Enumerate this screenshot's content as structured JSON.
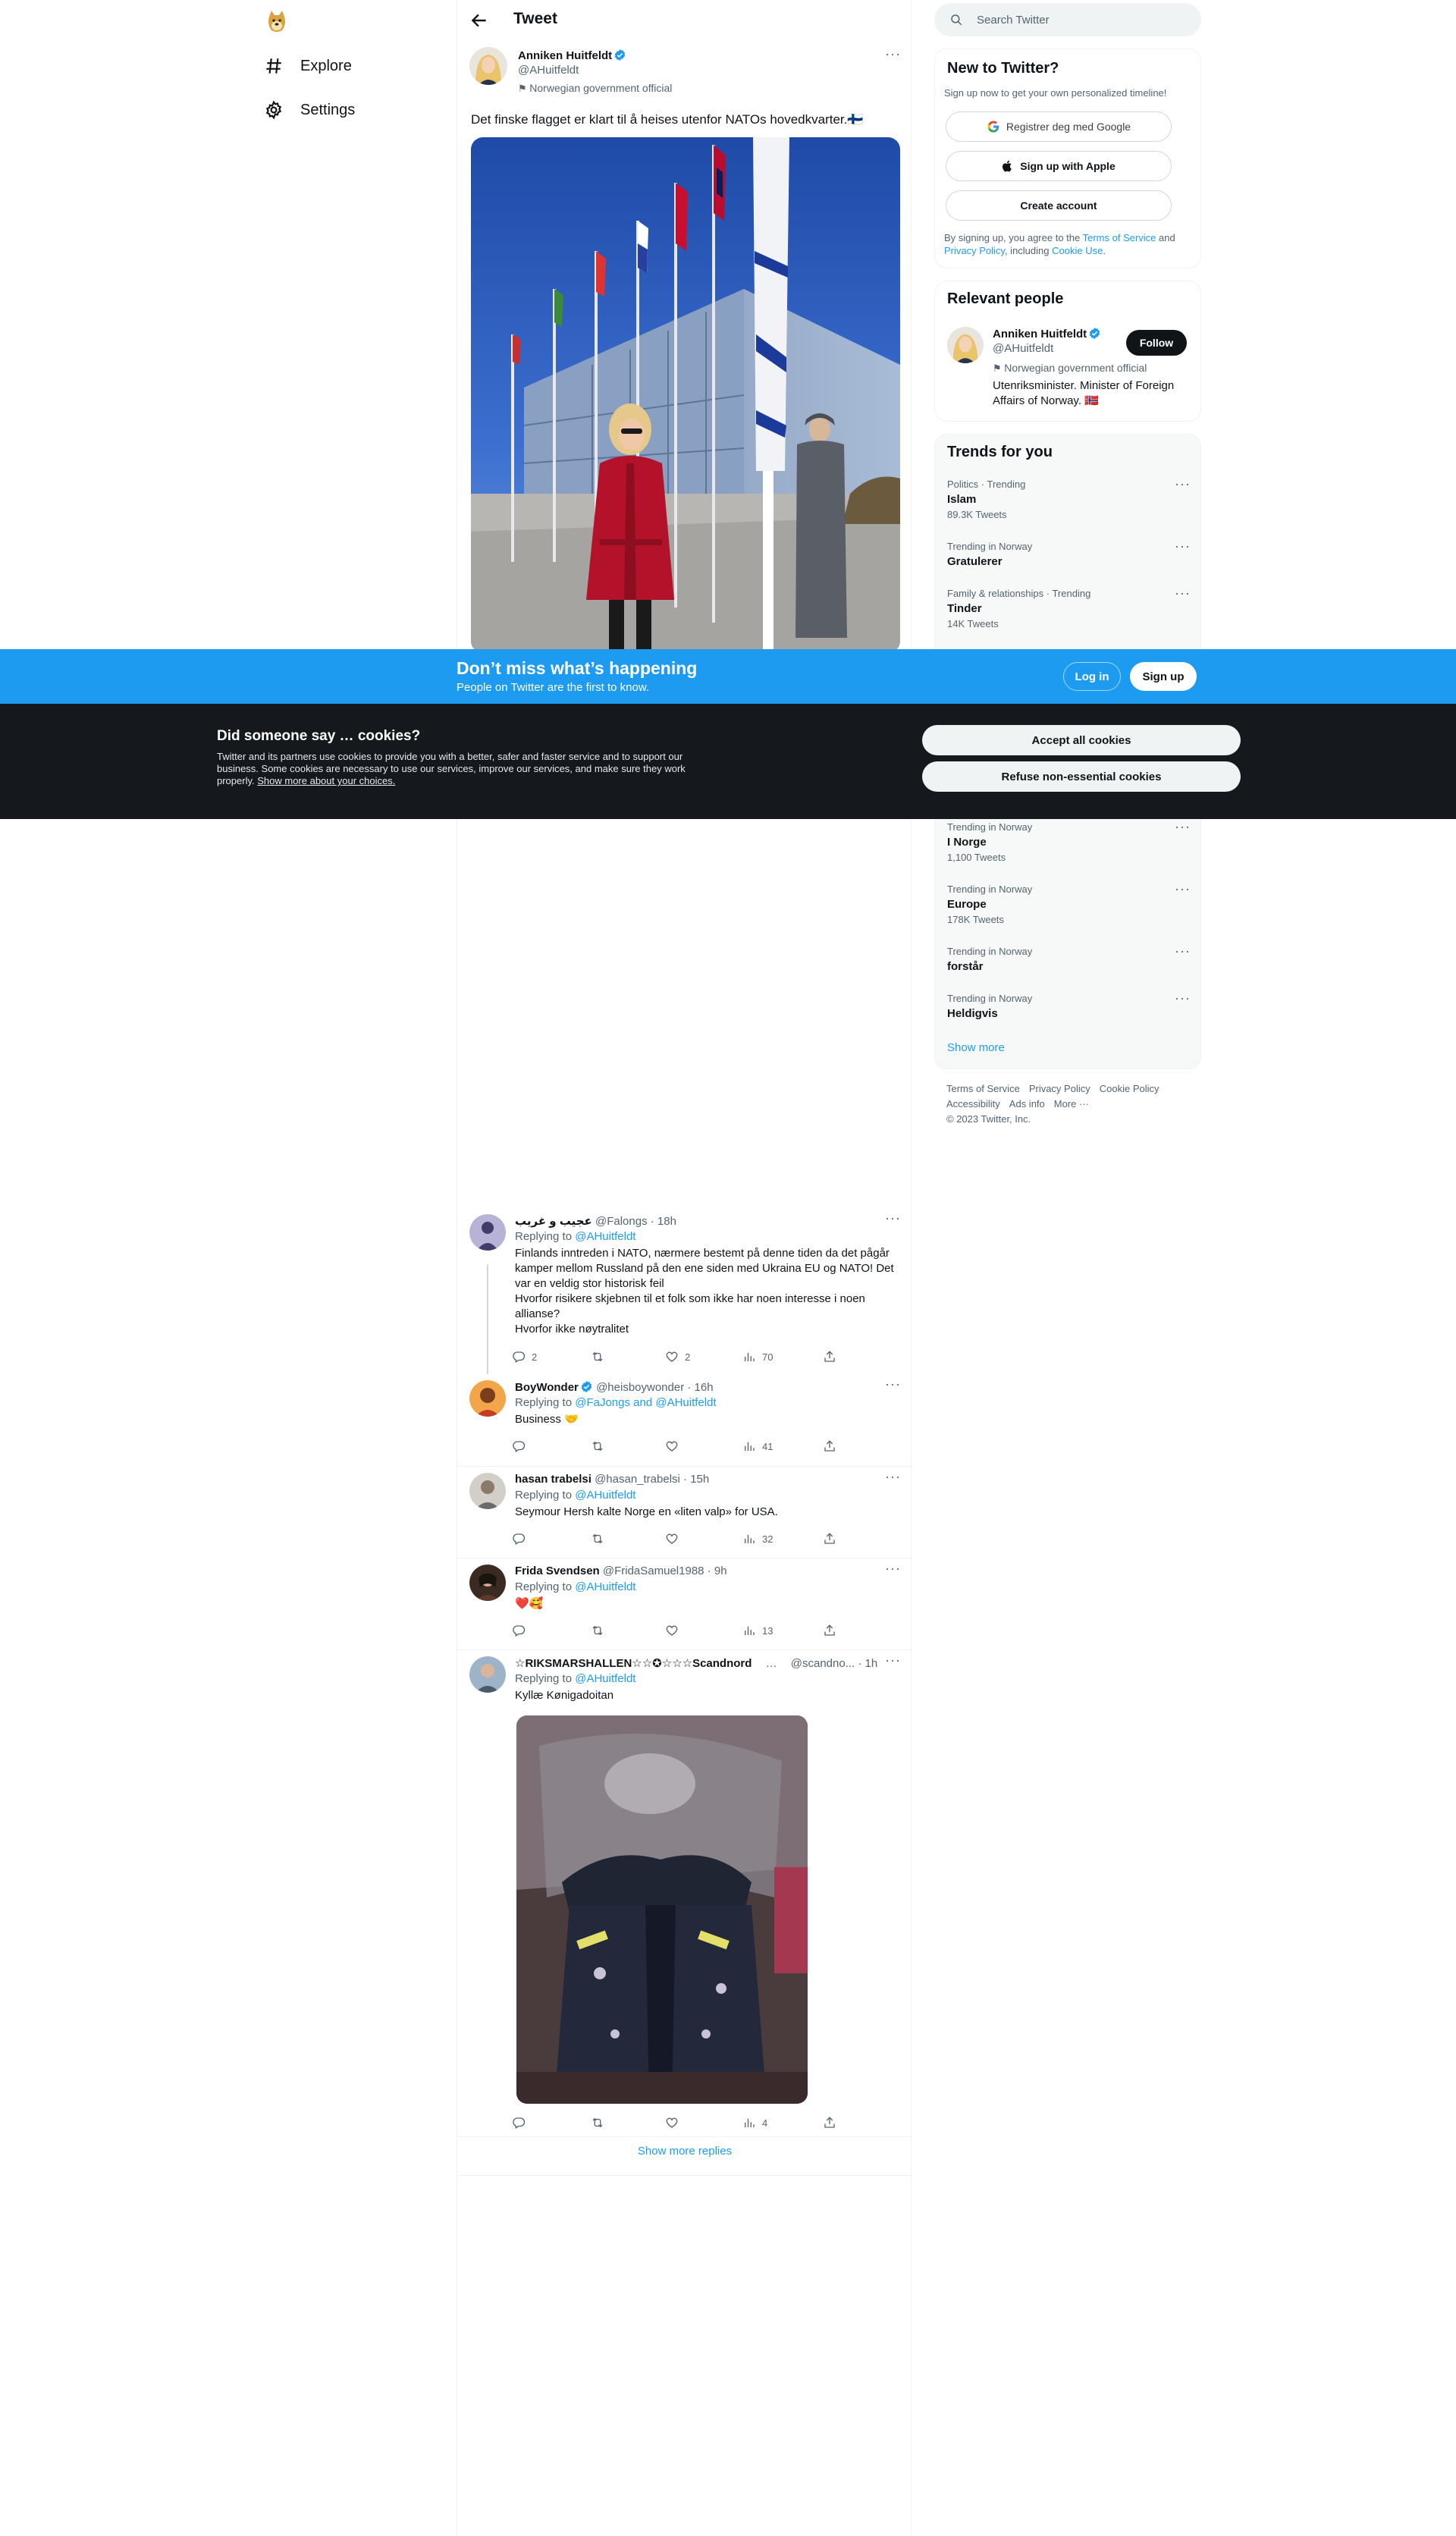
{
  "nav": {
    "explore_label": "Explore",
    "settings_label": "Settings"
  },
  "topbar": {
    "title": "Tweet"
  },
  "tweet": {
    "author_name": "Anniken Huitfeldt",
    "author_handle": "@AHuitfeldt",
    "affiliation": "Norwegian government official",
    "text": "Det finske flagget er klart til å heises utenfor NATOs hovedkvarter.🇫🇮"
  },
  "replies": [
    {
      "name": "عجيب و غريب",
      "handle": "@Falongs",
      "time": "· 18h",
      "replying_prefix": "Replying to ",
      "replying_to": "@AHuitfeldt",
      "text": "Finlands inntreden i NATO, nærmere bestemt på denne tiden da det pågår kamper mellom Russland på den ene siden med Ukraina EU og NATO! Det var en veldig stor historisk feil\nHvorfor risikere skjebnen til et folk som ikke har noen interesse i noen allianse?\nHvorfor ikke nøytralitet",
      "stats": {
        "replies": "2",
        "retweets": "",
        "likes": "2",
        "views": "70"
      }
    },
    {
      "name": "BoyWonder",
      "handle": "@heisboywonder",
      "time": "· 16h",
      "replying_prefix": "Replying to ",
      "replying_to": "@FaJongs and @AHuitfeldt",
      "text": "Business 🤝",
      "stats": {
        "replies": "",
        "retweets": "",
        "likes": "",
        "views": "41"
      }
    },
    {
      "name": "hasan trabelsi",
      "handle": "@hasan_trabelsi",
      "time": "· 15h",
      "replying_prefix": "Replying to ",
      "replying_to": "@AHuitfeldt",
      "text": "Seymour Hersh kalte Norge en «liten valp» for USA.",
      "stats": {
        "replies": "",
        "retweets": "",
        "likes": "",
        "views": "32"
      }
    },
    {
      "name": "Frida Svendsen",
      "handle": "@FridaSamuel1988",
      "time": "· 9h",
      "replying_prefix": "Replying to ",
      "replying_to": "@AHuitfeldt",
      "text": "❤️🥰",
      "stats": {
        "replies": "",
        "retweets": "",
        "likes": "",
        "views": "13"
      }
    },
    {
      "name": "☆RIKSMARSHALLEN☆☆✪☆☆☆Scandnord",
      "handle": "@scandno...",
      "time": "· 1h",
      "replying_prefix": "Replying to ",
      "replying_to": "@AHuitfeldt",
      "text": "Kyllæ Kønigadoitan",
      "stats": {
        "replies": "",
        "retweets": "",
        "likes": "",
        "views": "4"
      }
    }
  ],
  "show_more_replies": "Show more replies",
  "search": {
    "placeholder": "Search Twitter"
  },
  "signup_panel": {
    "title": "New to Twitter?",
    "subtitle": "Sign up now to get your own personalized timeline!",
    "google_label": "Registrer deg med Google",
    "apple_label": "Sign up with Apple",
    "create_label": "Create account",
    "terms_prefix": "By signing up, you agree to the ",
    "terms_link": "Terms of Service",
    "terms_and": " and ",
    "privacy_link": "Privacy Policy",
    "terms_including": ", including ",
    "cookie_link": "Cookie Use",
    "terms_end": "."
  },
  "relevant": {
    "title": "Relevant people",
    "name": "Anniken Huitfeldt",
    "handle": "@AHuitfeldt",
    "follow_label": "Follow",
    "affiliation": "Norwegian government official",
    "bio": "Utenriksminister. Minister of Foreign Affairs of Norway. 🇳🇴"
  },
  "trends": {
    "title": "Trends for you",
    "items_top": [
      {
        "context": "Politics · Trending",
        "name": "Islam",
        "count": "89.3K Tweets"
      },
      {
        "context": "Trending in Norway",
        "name": "Gratulerer",
        "count": ""
      },
      {
        "context": "Family & relationships · Trending",
        "name": "Tinder",
        "count": "14K Tweets"
      }
    ],
    "items_bottom": [
      {
        "context": "Trending in Norway",
        "name": "I Norge",
        "count": "1,100 Tweets"
      },
      {
        "context": "Trending in Norway",
        "name": "Europe",
        "count": "178K Tweets"
      },
      {
        "context": "Trending in Norway",
        "name": "forstår",
        "count": ""
      },
      {
        "context": "Trending in Norway",
        "name": "Heldigvis",
        "count": ""
      }
    ],
    "show_more": "Show more"
  },
  "footer": {
    "terms": "Terms of Service",
    "privacy": "Privacy Policy",
    "cookie": "Cookie Policy",
    "accessibility": "Accessibility",
    "ads": "Ads info",
    "more": "More ···",
    "copyright": "© 2023 Twitter, Inc."
  },
  "signup_bar": {
    "headline": "Don’t miss what’s happening",
    "subline": "People on Twitter are the first to know.",
    "login_label": "Log in",
    "signup_label": "Sign up"
  },
  "cookie_bar": {
    "title": "Did someone say … cookies?",
    "body": "Twitter and its partners use cookies to provide you with a better, safer and faster service and to support our business. Some cookies are necessary to use our services, improve our services, and make sure they work properly. ",
    "link": "Show more about your choices.",
    "accept_label": "Accept all cookies",
    "refuse_label": "Refuse non-essential cookies"
  },
  "colors": {
    "accent": "#1d9bf0",
    "cookie_bg": "#15181c",
    "text_primary": "#0f1419",
    "text_secondary": "#536471"
  },
  "icons": {
    "logo": "doge-logo-icon",
    "explore": "hashtag-icon",
    "settings": "gear-icon",
    "back": "arrow-left-icon",
    "verified": "verified-badge-icon",
    "reply": "reply-icon",
    "retweet": "retweet-icon",
    "like": "heart-icon",
    "views": "views-icon",
    "share": "share-icon",
    "search": "search-icon",
    "google": "google-icon",
    "apple": "apple-icon"
  }
}
